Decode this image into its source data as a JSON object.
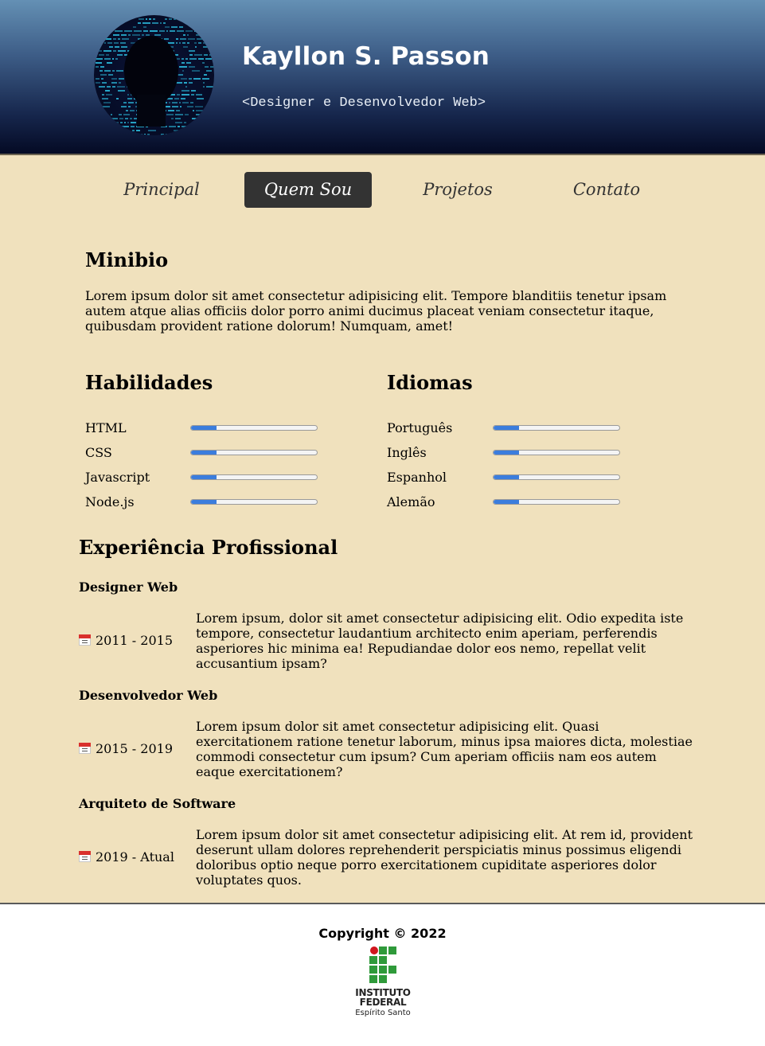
{
  "header": {
    "name": "Kayllon S. Passon",
    "tagline": "<Designer e Desenvolvedor Web>"
  },
  "nav": {
    "items": [
      "Principal",
      "Quem Sou",
      "Projetos",
      "Contato"
    ],
    "active": "Quem Sou"
  },
  "minibio": {
    "title": "Minibio",
    "text": "Lorem ipsum dolor sit amet consectetur adipisicing elit. Tempore blanditiis tenetur ipsam autem atque alias officiis dolor porro animi ducimus placeat veniam consectetur itaque, quibusdam provident ratione dolorum! Numquam, amet!"
  },
  "skills": {
    "title": "Habilidades",
    "items": [
      {
        "label": "HTML",
        "level": 0.2
      },
      {
        "label": "CSS",
        "level": 0.2
      },
      {
        "label": "Javascript",
        "level": 0.2
      },
      {
        "label": "Node.js",
        "level": 0.2
      }
    ]
  },
  "languages": {
    "title": "Idiomas",
    "items": [
      {
        "label": "Português",
        "level": 0.2
      },
      {
        "label": "Inglês",
        "level": 0.2
      },
      {
        "label": "Espanhol",
        "level": 0.2
      },
      {
        "label": "Alemão",
        "level": 0.2
      }
    ]
  },
  "experience": {
    "title": "Experiência Profissional",
    "jobs": [
      {
        "title": "Designer Web",
        "date": "2011 - 2015",
        "desc": "Lorem ipsum, dolor sit amet consectetur adipisicing elit. Odio expedita iste tempore, consectetur laudantium architecto enim aperiam, perferendis asperiores hic minima ea! Repudiandae dolor eos nemo, repellat velit accusantium ipsam?"
      },
      {
        "title": "Desenvolvedor Web",
        "date": "2015 - 2019",
        "desc": "Lorem ipsum dolor sit amet consectetur adipisicing elit. Quasi exercitationem ratione tenetur laborum, minus ipsa maiores dicta, molestiae commodi consectetur cum ipsum? Cum aperiam officiis nam eos autem eaque exercitationem?"
      },
      {
        "title": "Arquiteto de Software",
        "date": "2019 - Atual",
        "desc": "Lorem ipsum dolor sit amet consectetur adipisicing elit. At rem id, provident deserunt ullam dolores reprehenderit perspiciatis minus possimus eligendi doloribus optio neque porro exercitationem cupiditate asperiores dolor voluptates quos."
      }
    ]
  },
  "footer": {
    "copyright": "Copyright © 2022",
    "logo_line1": "INSTITUTO",
    "logo_line2": "FEDERAL",
    "logo_line3": "Espírito Santo"
  },
  "colors": {
    "page_bg": "#f0e1bd",
    "nav_active_bg": "#333333",
    "progress_fill": "#3b7ddd",
    "ifes_green": "#2f9a3a",
    "ifes_red": "#d0161e"
  }
}
